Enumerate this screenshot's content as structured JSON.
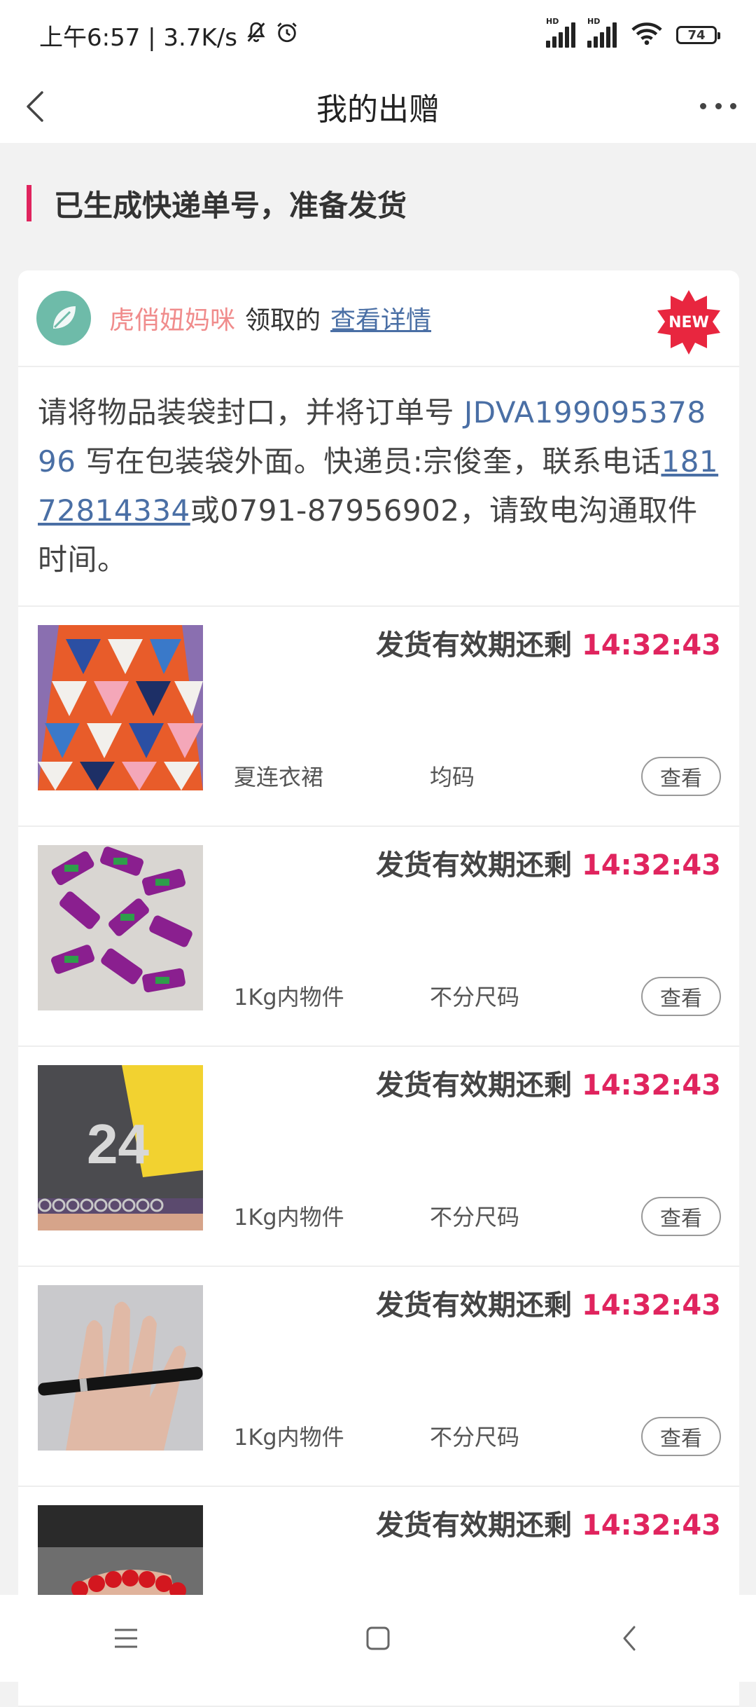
{
  "status_bar": {
    "time_text": "上午6:57 | 3.7K/s",
    "battery": "74",
    "hd_label": "HD"
  },
  "nav": {
    "title": "我的出赠"
  },
  "section": {
    "title": "已生成快递单号，准备发货"
  },
  "card": {
    "user_name": "虎俏妞妈咪",
    "claimed_text": "领取的",
    "detail_link": "查看详情",
    "new_badge": "NEW",
    "notice": {
      "part1": "请将物品装袋封口，并将订单号 ",
      "order_no": "JDVA19909537896",
      "part2": " 写在包装袋外面。快递员:宗俊奎，联系电话",
      "phone": "18172814334",
      "part3": "或0791-87956902，请致电沟通取件时间。"
    }
  },
  "items": [
    {
      "countdown_label": "发货有效期还剩",
      "countdown": "14:32:43",
      "name": "夏连衣裙",
      "size": "均码",
      "button": "查看"
    },
    {
      "countdown_label": "发货有效期还剩",
      "countdown": "14:32:43",
      "name": "1Kg内物件",
      "size": "不分尺码",
      "button": "查看"
    },
    {
      "countdown_label": "发货有效期还剩",
      "countdown": "14:32:43",
      "name": "1Kg内物件",
      "size": "不分尺码",
      "button": "查看"
    },
    {
      "countdown_label": "发货有效期还剩",
      "countdown": "14:32:43",
      "name": "1Kg内物件",
      "size": "不分尺码",
      "button": "查看"
    },
    {
      "countdown_label": "发货有效期还剩",
      "countdown": "14:32:43"
    }
  ],
  "colors": {
    "accent": "#e0245e",
    "link": "#4a6fa5",
    "user_name": "#f08c8c"
  }
}
